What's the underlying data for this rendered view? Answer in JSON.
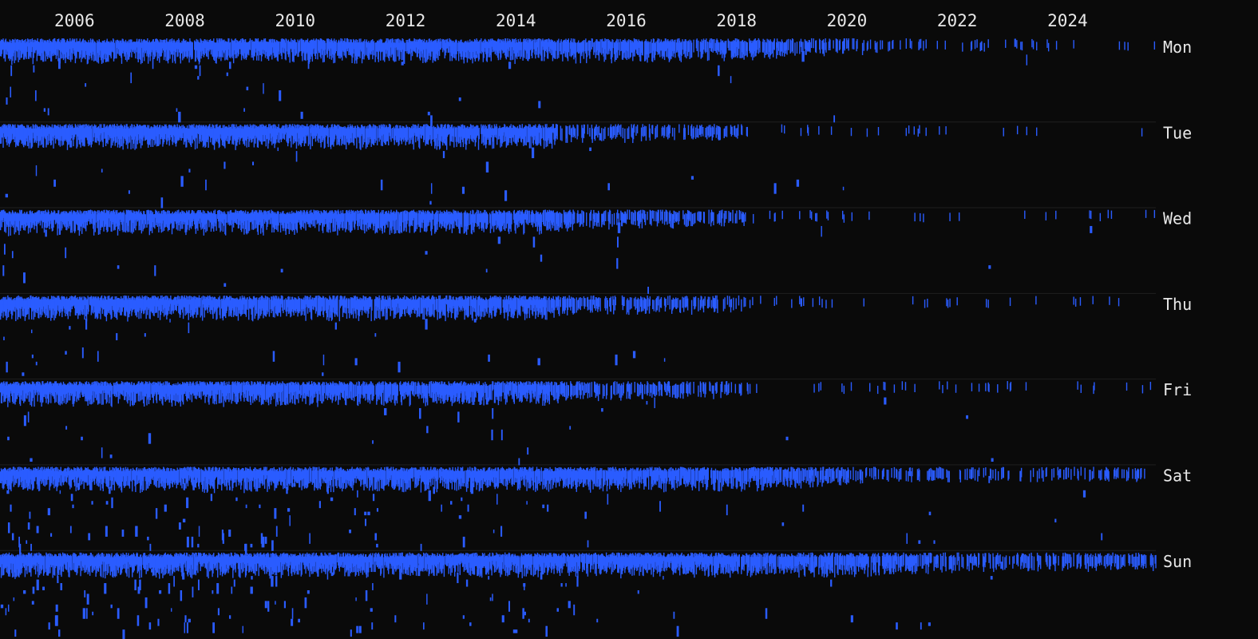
{
  "chart_data": {
    "type": "heatmap",
    "title": "",
    "xlabel": "",
    "ylabel": "",
    "x_axis": {
      "type": "time",
      "range": [
        2004.65,
        2025.6
      ],
      "tick_labels": [
        "2006",
        "2008",
        "2010",
        "2012",
        "2014",
        "2016",
        "2018",
        "2020",
        "2022",
        "2024"
      ],
      "tick_values": [
        2006,
        2008,
        2010,
        2012,
        2014,
        2016,
        2018,
        2020,
        2022,
        2024
      ],
      "position": "top"
    },
    "y_axis": {
      "type": "category",
      "categories": [
        "Mon",
        "Tue",
        "Wed",
        "Thu",
        "Fri",
        "Sat",
        "Sun"
      ],
      "position": "right",
      "hours_per_day": 24
    },
    "mark_color": "#2a5cff",
    "grid": true,
    "legend": "none",
    "bands": [
      {
        "day": "Mon",
        "density": [
          [
            2004.65,
            1.0
          ],
          [
            2014,
            0.95
          ],
          [
            2017,
            0.85
          ],
          [
            2018.5,
            0.7
          ],
          [
            2019.6,
            0.45
          ],
          [
            2021.4,
            0.12
          ],
          [
            2025.6,
            0.02
          ]
        ],
        "sparse": [
          [
            2004.65,
            0.35
          ],
          [
            2006.5,
            0.08
          ],
          [
            2011.5,
            0.1
          ],
          [
            2018,
            0.03
          ],
          [
            2025.6,
            0.01
          ]
        ]
      },
      {
        "day": "Tue",
        "density": [
          [
            2004.65,
            1.0
          ],
          [
            2014.5,
            0.95
          ],
          [
            2015.2,
            0.5
          ],
          [
            2017.7,
            0.45
          ],
          [
            2018.4,
            0.05
          ],
          [
            2025.6,
            0.03
          ]
        ],
        "sparse": [
          [
            2004.65,
            0.3
          ],
          [
            2006.5,
            0.06
          ],
          [
            2015,
            0.05
          ],
          [
            2018,
            0.02
          ],
          [
            2025.6,
            0.01
          ]
        ]
      },
      {
        "day": "Wed",
        "density": [
          [
            2004.65,
            1.0
          ],
          [
            2014.5,
            0.92
          ],
          [
            2015.2,
            0.55
          ],
          [
            2017.9,
            0.45
          ],
          [
            2018.4,
            0.06
          ],
          [
            2025.6,
            0.03
          ]
        ],
        "sparse": [
          [
            2004.65,
            0.3
          ],
          [
            2006.5,
            0.06
          ],
          [
            2015,
            0.05
          ],
          [
            2018,
            0.02
          ],
          [
            2025.6,
            0.01
          ]
        ]
      },
      {
        "day": "Thu",
        "density": [
          [
            2004.65,
            1.0
          ],
          [
            2014.5,
            0.92
          ],
          [
            2015.2,
            0.55
          ],
          [
            2017.9,
            0.45
          ],
          [
            2018.4,
            0.06
          ],
          [
            2025.6,
            0.03
          ]
        ],
        "sparse": [
          [
            2004.65,
            0.3
          ],
          [
            2006.5,
            0.06
          ],
          [
            2015,
            0.05
          ],
          [
            2018,
            0.02
          ],
          [
            2025.6,
            0.01
          ]
        ]
      },
      {
        "day": "Fri",
        "density": [
          [
            2004.65,
            1.0
          ],
          [
            2014.5,
            0.92
          ],
          [
            2015.2,
            0.55
          ],
          [
            2017.9,
            0.45
          ],
          [
            2018.4,
            0.06
          ],
          [
            2025.6,
            0.03
          ]
        ],
        "sparse": [
          [
            2004.65,
            0.3
          ],
          [
            2006.5,
            0.06
          ],
          [
            2015,
            0.05
          ],
          [
            2018,
            0.02
          ],
          [
            2025.6,
            0.01
          ]
        ]
      },
      {
        "day": "Sat",
        "density": [
          [
            2004.65,
            1.0
          ],
          [
            2014.5,
            0.95
          ],
          [
            2018.5,
            0.9
          ],
          [
            2019.7,
            0.55
          ],
          [
            2021,
            0.25
          ],
          [
            2025.6,
            0.3
          ]
        ],
        "sparse": [
          [
            2004.65,
            0.45
          ],
          [
            2014,
            0.2
          ],
          [
            2016,
            0.08
          ],
          [
            2018,
            0.04
          ],
          [
            2025.6,
            0.02
          ]
        ]
      },
      {
        "day": "Sun",
        "density": [
          [
            2004.65,
            1.0
          ],
          [
            2014.5,
            0.97
          ],
          [
            2018.5,
            0.95
          ],
          [
            2020.5,
            0.85
          ],
          [
            2022,
            0.55
          ],
          [
            2025.6,
            0.5
          ]
        ],
        "sparse": [
          [
            2004.65,
            0.5
          ],
          [
            2014,
            0.25
          ],
          [
            2016,
            0.1
          ],
          [
            2018,
            0.05
          ],
          [
            2025.6,
            0.02
          ]
        ]
      }
    ]
  }
}
